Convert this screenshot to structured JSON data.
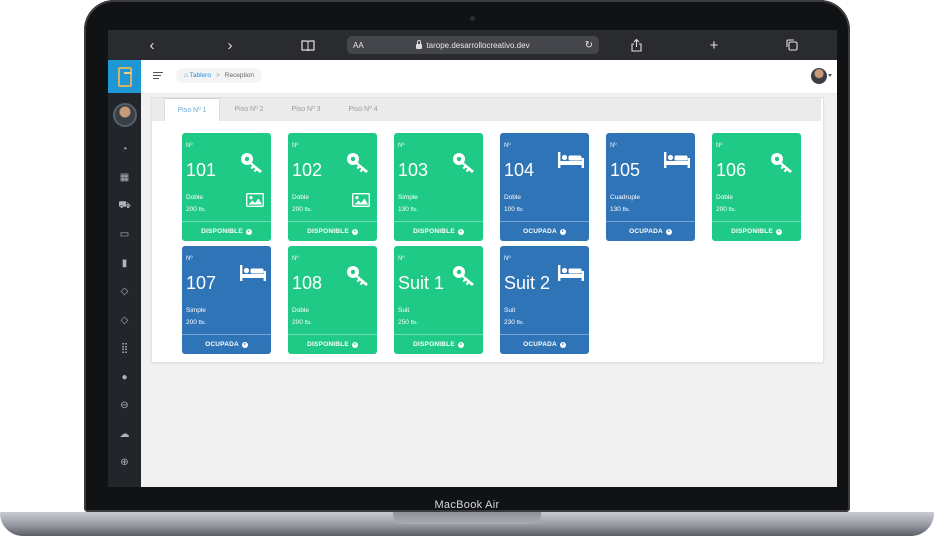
{
  "device": {
    "label": "MacBook Air"
  },
  "browser": {
    "text_size_label": "AA",
    "url": "tarope.desarrollocreativo.dev",
    "back_icon": "‹",
    "forward_icon": "›",
    "reload_icon": "↻",
    "new_tab_icon": "+"
  },
  "breadcrumb": {
    "home": "Tablero",
    "separator": ">",
    "current": "Reception"
  },
  "floors": [
    {
      "label": "Piso Nº 1",
      "active": true
    },
    {
      "label": "Piso Nº 2",
      "active": false
    },
    {
      "label": "Piso Nº 3",
      "active": false
    },
    {
      "label": "Piso Nº 4",
      "active": false
    }
  ],
  "rooms": [
    {
      "label": "Nº",
      "number": "101",
      "type": "Doble",
      "price": "200",
      "currency": "Bs.",
      "status": "DISPONIBLE",
      "state": "disponible",
      "icon": "key-icon",
      "has_image": true
    },
    {
      "label": "Nº",
      "number": "102",
      "type": "Doble",
      "price": "200",
      "currency": "Bs.",
      "status": "DISPONIBLE",
      "state": "disponible",
      "icon": "key-icon",
      "has_image": true
    },
    {
      "label": "Nº",
      "number": "103",
      "type": "Simple",
      "price": "130",
      "currency": "Bs.",
      "status": "DISPONIBLE",
      "state": "disponible",
      "icon": "key-icon",
      "has_image": false
    },
    {
      "label": "Nº",
      "number": "104",
      "type": "Doble",
      "price": "100",
      "currency": "Bs.",
      "status": "OCUPADA",
      "state": "ocupada",
      "icon": "bed-icon",
      "has_image": false
    },
    {
      "label": "Nº",
      "number": "105",
      "type": "Cuadruple",
      "price": "130",
      "currency": "Bs.",
      "status": "OCUPADA",
      "state": "ocupada",
      "icon": "bed-icon",
      "has_image": false
    },
    {
      "label": "Nº",
      "number": "106",
      "type": "Doble",
      "price": "200",
      "currency": "Bs.",
      "status": "DISPONIBLE",
      "state": "disponible",
      "icon": "key-icon",
      "has_image": false
    },
    {
      "label": "Nº",
      "number": "107",
      "type": "Simple",
      "price": "200",
      "currency": "Bs.",
      "status": "OCUPADA",
      "state": "ocupada",
      "icon": "bed-icon",
      "has_image": false
    },
    {
      "label": "Nº",
      "number": "108",
      "type": "Doble",
      "price": "200",
      "currency": "Bs.",
      "status": "DISPONIBLE",
      "state": "disponible",
      "icon": "key-icon",
      "has_image": false
    },
    {
      "label": "Nº",
      "number": "Suit 1",
      "type": "Suit",
      "price": "250",
      "currency": "Bs.",
      "status": "DISPONIBLE",
      "state": "disponible",
      "icon": "key-icon",
      "has_image": false
    },
    {
      "label": "Nº",
      "number": "Suit 2",
      "type": "Suit",
      "price": "230",
      "currency": "Bs.",
      "status": "OCUPADA",
      "state": "ocupada",
      "icon": "bed-icon",
      "has_image": false
    }
  ],
  "sidebar_icons": [
    "dashboard-icon",
    "calendar-icon",
    "cart-icon",
    "folder-icon",
    "book-icon",
    "tag-icon",
    "tag-outline-icon",
    "grid-icon",
    "circle-icon",
    "lock-icon",
    "cloud-icon",
    "globe-icon"
  ],
  "colors": {
    "disponible": "#1fc986",
    "ocupada": "#2f74b7",
    "logo": "#1f97d5",
    "sidebar": "#22262b"
  }
}
